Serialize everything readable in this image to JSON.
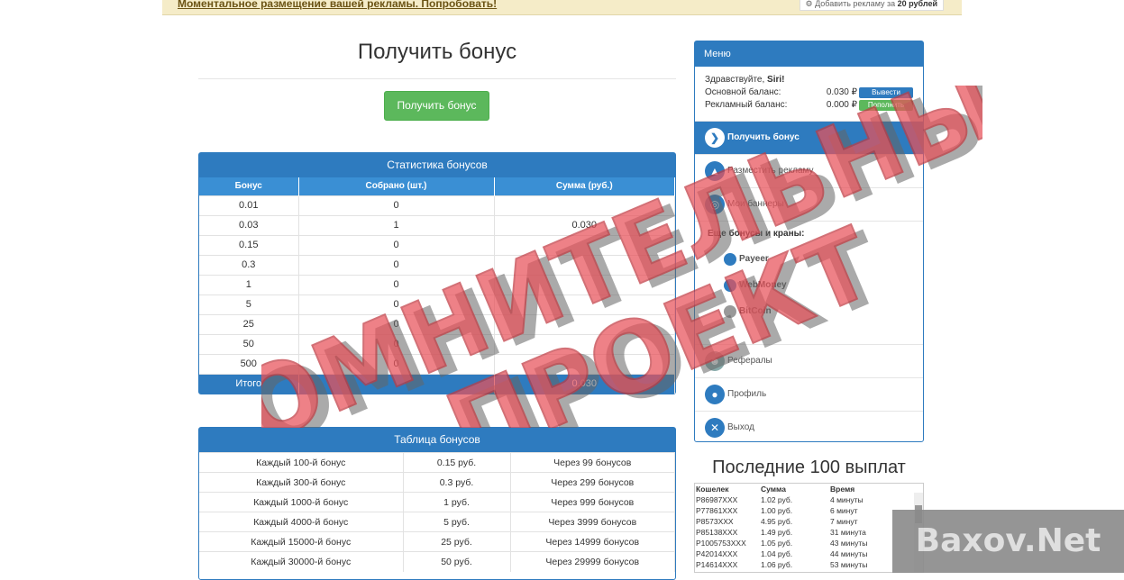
{
  "topbar": {
    "promo_text": "Моментальное размещение вашей рекламы. Попробовать!",
    "add_ad_prefix": "Добавить рекламу за ",
    "add_ad_price": "20 рублей"
  },
  "main": {
    "title": "Получить бонус",
    "get_bonus_label": "Получить бонус"
  },
  "stats": {
    "title": "Статистика бонусов",
    "columns": [
      "Бонус",
      "Собрано (шт.)",
      "Сумма (руб.)"
    ],
    "rows": [
      [
        "0.01",
        "0",
        ""
      ],
      [
        "0.03",
        "1",
        "0.030"
      ],
      [
        "0.15",
        "0",
        ""
      ],
      [
        "0.3",
        "0",
        ""
      ],
      [
        "1",
        "0",
        ""
      ],
      [
        "5",
        "0",
        ""
      ],
      [
        "25",
        "0",
        ""
      ],
      [
        "50",
        "0",
        ""
      ],
      [
        "500",
        "0",
        ""
      ]
    ],
    "total": [
      "Итого",
      "",
      "0.030"
    ]
  },
  "prizes": {
    "title": "Таблица бонусов",
    "rows": [
      [
        "Каждый 100-й бонус",
        "0.15 руб.",
        "Через 99 бонусов"
      ],
      [
        "Каждый 300-й бонус",
        "0.3 руб.",
        "Через 299 бонусов"
      ],
      [
        "Каждый 1000-й бонус",
        "1 руб.",
        "Через 999 бонусов"
      ],
      [
        "Каждый 4000-й бонус",
        "5 руб.",
        "Через 3999 бонусов"
      ],
      [
        "Каждый 15000-й бонус",
        "25 руб.",
        "Через 14999 бонусов"
      ],
      [
        "Каждый 30000-й бонус",
        "50 руб.",
        "Через 29999 бонусов"
      ]
    ]
  },
  "menu": {
    "title": "Меню",
    "greeting_prefix": "Здравствуйте, ",
    "username": "Siri!",
    "main_balance_label": "Основной баланс:",
    "main_balance_value": "0.030 ₽",
    "withdraw_label": "Вывести",
    "ad_balance_label": "Рекламный баланс:",
    "ad_balance_value": "0.000 ₽",
    "topup_label": "Пополнить",
    "items": [
      {
        "label": "Получить бонус",
        "icon": "chevron-right-icon"
      },
      {
        "label": "Разместить рекламу",
        "icon": "megaphone-icon"
      },
      {
        "label": "Мои баннеры",
        "icon": "target-icon"
      }
    ],
    "more_label": "Еще бонусы и краны:",
    "payment_systems": [
      "Payeer",
      "WebMoney",
      "BitCoin"
    ],
    "bottom_items": [
      {
        "label": "Рефералы",
        "icon": "users-icon"
      },
      {
        "label": "Профиль",
        "icon": "user-icon"
      },
      {
        "label": "Выход",
        "icon": "close-icon"
      }
    ]
  },
  "payouts": {
    "title": "Последние 100 выплат",
    "columns": [
      "Кошелек",
      "Сумма",
      "Время"
    ],
    "rows": [
      [
        "P86987XXX",
        "1.02 руб.",
        "4 минуты"
      ],
      [
        "P77861XXX",
        "1.00 руб.",
        "6 минут"
      ],
      [
        "P8573XXX",
        "4.95 руб.",
        "7 минут"
      ],
      [
        "P85138XXX",
        "1.49 руб.",
        "31 минута"
      ],
      [
        "P1005753XXX",
        "1.05 руб.",
        "43 минуты"
      ],
      [
        "P42014XXX",
        "1.04 руб.",
        "44 минуты"
      ],
      [
        "P14614XXX",
        "1.06 руб.",
        "53 минуты"
      ]
    ]
  },
  "watermark": {
    "line1": "СОМНИТЕЛЬНЫЙ",
    "line2": "ПРОЕКТ",
    "site": "Baxov.Net"
  }
}
